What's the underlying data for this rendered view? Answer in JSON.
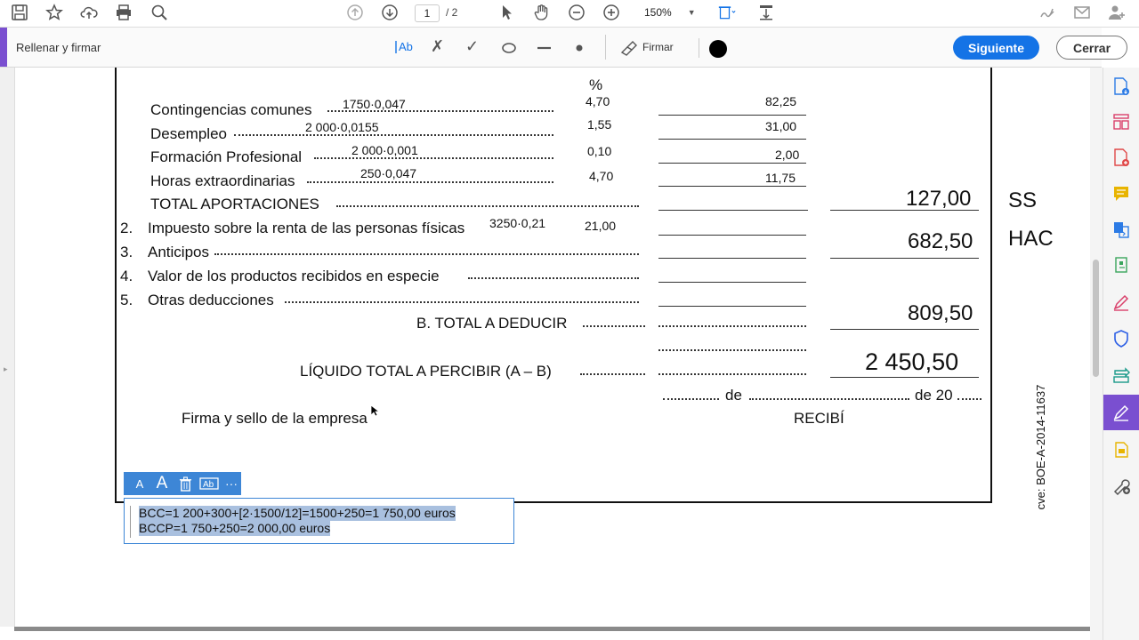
{
  "toolbar": {
    "page_current": "1",
    "page_total": "/ 2",
    "zoom": "150%"
  },
  "fillbar": {
    "title": "Rellenar y firmar",
    "sign_label": "Firmar",
    "next_label": "Siguiente",
    "close_label": "Cerrar"
  },
  "doc": {
    "percent_header": "%",
    "rows": [
      {
        "label": "Contingencias comunes",
        "calc": "1750·0,047",
        "pct": "4,70",
        "amount": "82,25"
      },
      {
        "label": "Desempleo",
        "calc": "2 000·0,0155",
        "pct": "1,55",
        "amount": "31,00"
      },
      {
        "label": "Formación Profesional",
        "calc": "2 000·0,001",
        "pct": "0,10",
        "amount": "2,00"
      },
      {
        "label": "Horas extraordinarias",
        "calc": "250·0,047",
        "pct": "4,70",
        "amount": "11,75"
      }
    ],
    "total_aport_label": "TOTAL APORTACIONES",
    "total_aport_value": "127,00",
    "ss_label": "SS",
    "item2_num": "2.",
    "item2_label": "Impuesto sobre la renta de las personas físicas",
    "item2_calc": "3250·0,21",
    "item2_pct": "21,00",
    "item2_value": "682,50",
    "hac_label": "HAC",
    "item3_num": "3.",
    "item3_label": "Anticipos",
    "item4_num": "4.",
    "item4_label": "Valor de los productos recibidos en especie",
    "item5_num": "5.",
    "item5_label": "Otras deducciones",
    "total_deducir_label": "B. TOTAL A DEDUCIR",
    "total_deducir_value": "809,50",
    "liquido_label": "LÍQUIDO TOTAL A PERCIBIR (A – B)",
    "liquido_value": "2 450,50",
    "date_de1": "de",
    "date_de2": "de 20",
    "firma_label": "Firma y sello de la empresa",
    "recibi_label": "RECIBÍ",
    "cve_label": "cve: BOE-A-2014-11637"
  },
  "textbox": {
    "line1": "BCC=1 200+300+[2·1500/12]=1500+250=1 750,00 euros",
    "line2": "BCCP=1 750+250=2 000,00 euros",
    "tool_small_a": "A",
    "tool_large_a": "A",
    "tool_more": "···"
  },
  "colors": {
    "accent_purple": "#7a4fd0",
    "primary_blue": "#1473e6",
    "textbox_toolbar": "#3d86d6",
    "selection": "#a9c0df"
  }
}
